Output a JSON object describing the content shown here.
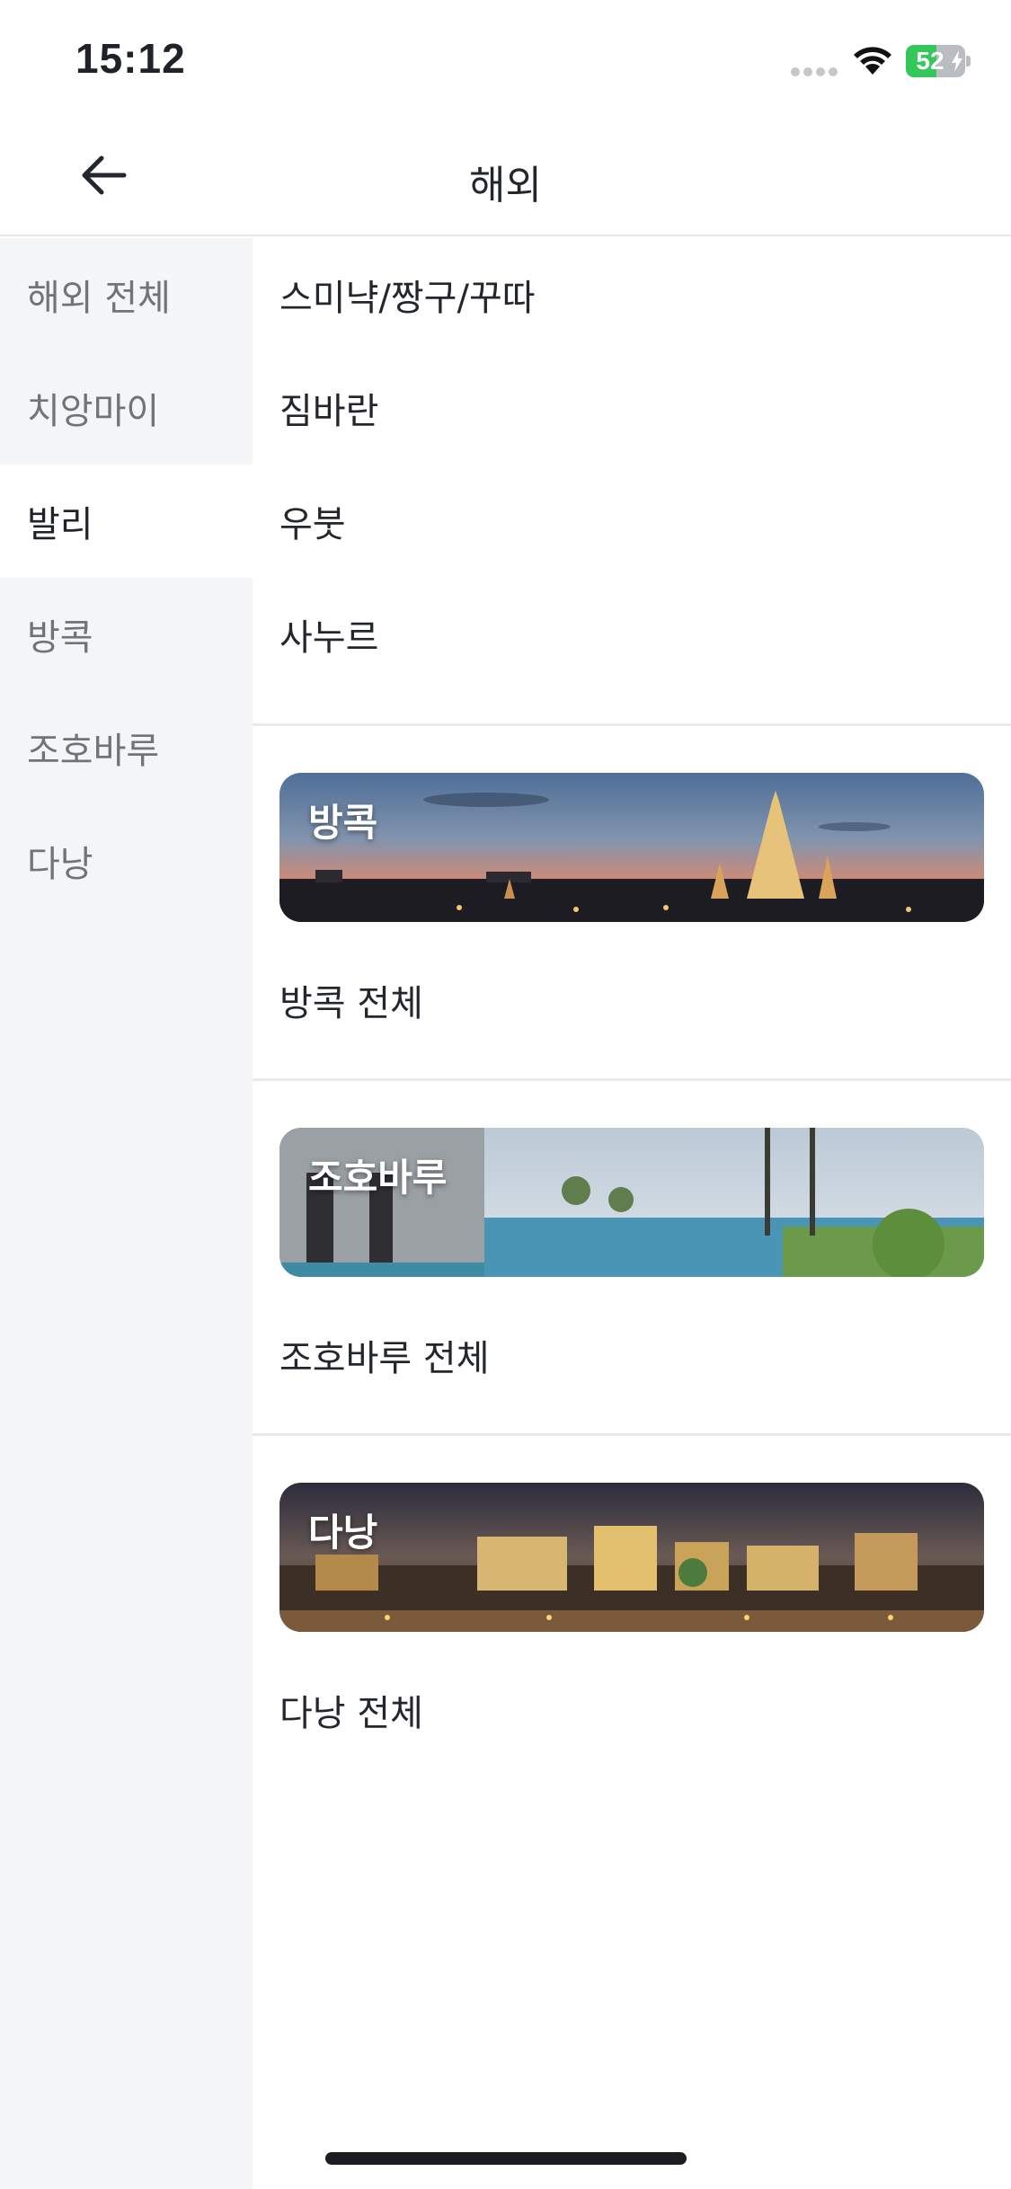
{
  "status_bar": {
    "time": "15:12",
    "battery_percent": 52,
    "battery_label": "52"
  },
  "header": {
    "title": "해외",
    "back_icon": "arrow-left-icon"
  },
  "sidebar": {
    "items": [
      {
        "label": "해외 전체",
        "active": false
      },
      {
        "label": "치앙마이",
        "active": false
      },
      {
        "label": "발리",
        "active": true
      },
      {
        "label": "방콕",
        "active": false
      },
      {
        "label": "조호바루",
        "active": false
      },
      {
        "label": "다낭",
        "active": false
      }
    ]
  },
  "content": {
    "bali_regions": [
      "스미냑/짱구/꾸따",
      "짐바란",
      "우붓",
      "사누르"
    ],
    "sections": [
      {
        "banner_label": "방콕",
        "all_label": "방콕 전체"
      },
      {
        "banner_label": "조호바루",
        "all_label": "조호바루 전체"
      },
      {
        "banner_label": "다낭",
        "all_label": "다낭 전체"
      }
    ]
  },
  "colors": {
    "sidebar_bg": "#f4f5f7",
    "active_text": "#1f2329",
    "inactive_text": "#6f747b",
    "battery_green": "#34c759"
  }
}
